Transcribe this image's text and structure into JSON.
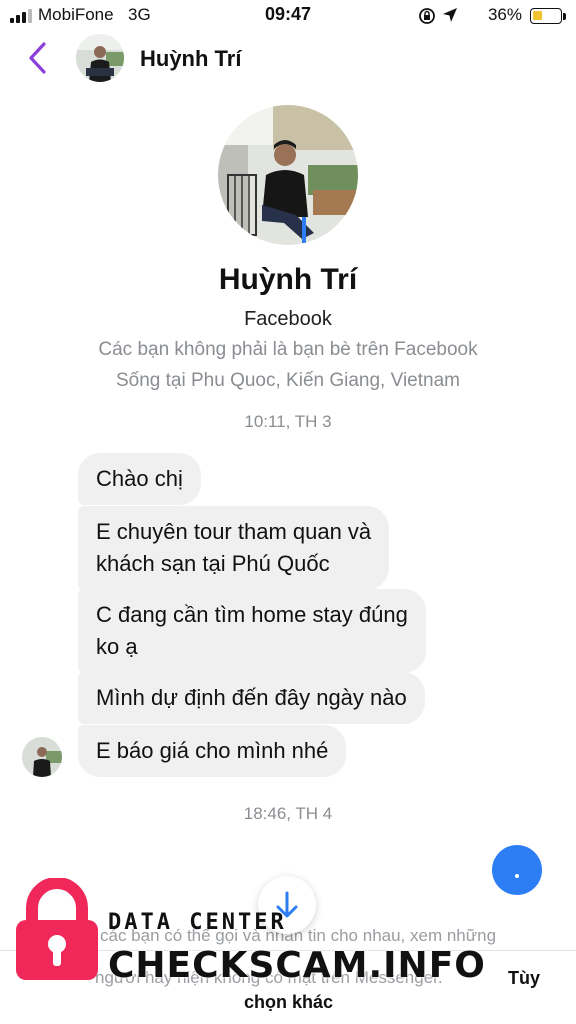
{
  "status_bar": {
    "carrier": "MobiFone",
    "network": "3G",
    "time": "09:47",
    "battery_percent": "36%",
    "battery_level": 0.36,
    "battery_color": "#f2c230"
  },
  "header": {
    "name": "Huỳnh Trí",
    "back_icon": "chevron-left-icon",
    "accent_color": "#8b3fd9"
  },
  "profile": {
    "name": "Huỳnh Trí",
    "source": "Facebook",
    "note": "Các bạn không phải là bạn bè trên Facebook",
    "location": "Sống tại Phu Quoc, Kiến Giang, Vietnam"
  },
  "timestamps": [
    "10:11, TH 3",
    "18:46, TH 4"
  ],
  "messages": [
    {
      "lines": [
        "Chào chị"
      ]
    },
    {
      "lines": [
        "E chuyên tour tham quan và",
        "khách sạn tại Phú Quốc"
      ]
    },
    {
      "lines": [
        "C đang cần tìm home stay đúng",
        "ko ạ"
      ]
    },
    {
      "lines": [
        "Mình dự định đến đây ngày nào"
      ]
    },
    {
      "lines": [
        "E báo giá cho mình nhé"
      ]
    }
  ],
  "bottom": {
    "notice_line1": "các bạn có thể gọi và nhắn tin cho nhau, xem những",
    "notice_line2": "người hay hiện không có mặt trên Messenger.",
    "more_options_line1": "Tùy",
    "more_options_line2": "chọn khác"
  },
  "watermark": {
    "subtitle": "DATA CENTER",
    "title": "CHECKSCAM.INFO",
    "lock_color": "#f0285a"
  },
  "fab_color": "#2d7df5"
}
